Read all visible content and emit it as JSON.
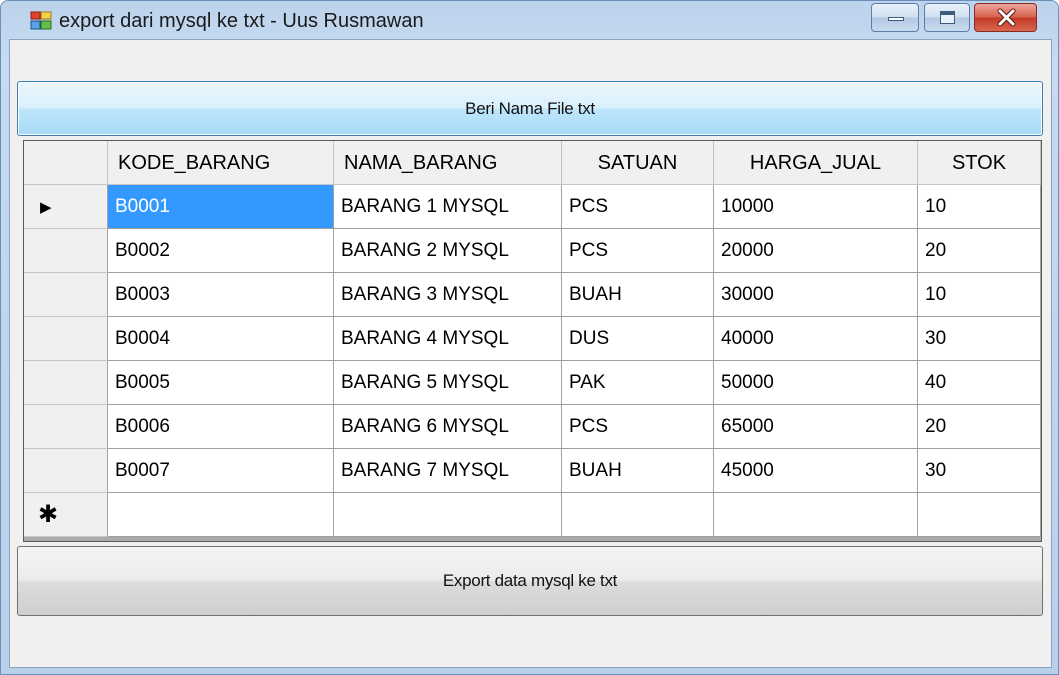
{
  "window": {
    "title": "export dari mysql ke txt - Uus Rusmawan",
    "app_icon": "windows-forms-icon",
    "controls": {
      "minimize_icon": "minimize-icon",
      "maximize_icon": "maximize-icon",
      "close_icon": "close-icon"
    }
  },
  "buttons": {
    "name_file": "Beri Nama File txt",
    "export": "Export data mysql ke txt"
  },
  "grid": {
    "columns": [
      "KODE_BARANG",
      "NAMA_BARANG",
      "SATUAN",
      "HARGA_JUAL",
      "STOK"
    ],
    "rows": [
      [
        "B0001",
        "BARANG 1 MYSQL",
        "PCS",
        "10000",
        "10"
      ],
      [
        "B0002",
        "BARANG 2 MYSQL",
        "PCS",
        "20000",
        "20"
      ],
      [
        "B0003",
        "BARANG 3 MYSQL",
        "BUAH",
        "30000",
        "10"
      ],
      [
        "B0004",
        "BARANG 4 MYSQL",
        "DUS",
        "40000",
        "30"
      ],
      [
        "B0005",
        "BARANG 5 MYSQL",
        "PAK",
        "50000",
        "40"
      ],
      [
        "B0006",
        "BARANG 6 MYSQL",
        "PCS",
        "65000",
        "20"
      ],
      [
        "B0007",
        "BARANG 7 MYSQL",
        "BUAH",
        "45000",
        "30"
      ]
    ],
    "selected_row": 0,
    "selected_column": 0,
    "current_row_marker": "▶",
    "new_row_marker": "✱"
  },
  "colors": {
    "selection": "#3399ff",
    "titlebar": "#c6dbf1",
    "close_button": "#c23a26"
  }
}
